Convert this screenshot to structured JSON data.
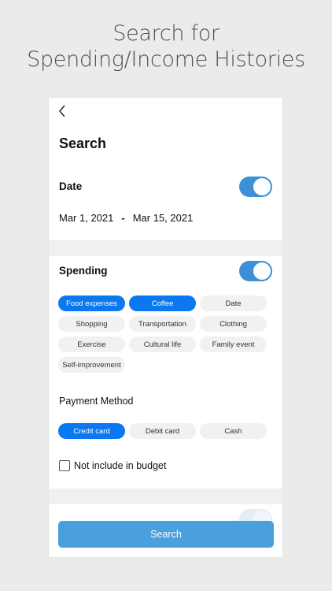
{
  "headline": {
    "line1": "Search for",
    "line2": "Spending/Income Histories"
  },
  "screen": {
    "back_icon": "chevron-left",
    "title": "Search",
    "date_section": {
      "label": "Date",
      "toggle_on": true,
      "start": "Mar 1, 2021",
      "separator": "-",
      "end": "Mar 15, 2021"
    },
    "spending_section": {
      "label": "Spending",
      "toggle_on": true,
      "categories": [
        {
          "label": "Food expenses",
          "selected": true
        },
        {
          "label": "Coffee",
          "selected": true
        },
        {
          "label": "Date",
          "selected": false
        },
        {
          "label": "Shopping",
          "selected": false
        },
        {
          "label": "Transportation",
          "selected": false
        },
        {
          "label": "Clothing",
          "selected": false
        },
        {
          "label": "Exercise",
          "selected": false
        },
        {
          "label": "Cultural life",
          "selected": false
        },
        {
          "label": "Family event",
          "selected": false
        },
        {
          "label": "Self-improvement",
          "selected": false
        }
      ]
    },
    "payment_method": {
      "label": "Payment Method",
      "options": [
        {
          "label": "Credit card",
          "selected": true
        },
        {
          "label": "Debit card",
          "selected": false
        },
        {
          "label": "Cash",
          "selected": false
        }
      ]
    },
    "budget_checkbox": {
      "label": "Not include in budget",
      "checked": false
    },
    "search_button": "Search"
  },
  "colors": {
    "accent": "#0a78f0",
    "toggle": "#3d8fd6",
    "button": "#4a9fdd",
    "background": "#ebebeb"
  }
}
